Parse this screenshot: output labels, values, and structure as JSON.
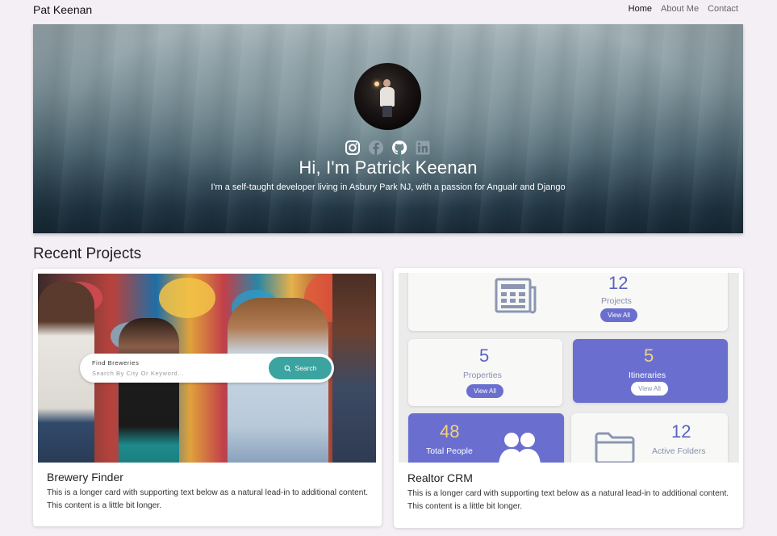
{
  "nav": {
    "brand": "Pat Keenan",
    "links": [
      "Home",
      "About Me",
      "Contact"
    ]
  },
  "hero": {
    "title": "Hi, I'm Patrick Keenan",
    "subtitle": "I'm a self-taught developer living in Asbury Park NJ, with a passion for Angualr and Django",
    "socials": [
      "instagram-icon",
      "facebook-icon",
      "github-icon",
      "linkedin-icon"
    ]
  },
  "projects": {
    "section_title": "Recent Projects",
    "cards": [
      {
        "title": "Brewery Finder",
        "text": "This is a longer card with supporting text below as a natural lead-in to additional content. This content is a little bit longer.",
        "image": {
          "search_label": "Find Breweries",
          "search_placeholder": "Search By City Or Keyword...",
          "search_button": "Search"
        }
      },
      {
        "title": "Realtor CRM",
        "text": "This is a longer card with supporting text below as a natural lead-in to additional content. This content is a little bit longer.",
        "image": {
          "projects": {
            "value": "12",
            "label": "Projects",
            "button": "View All"
          },
          "properties": {
            "value": "5",
            "label": "Properties",
            "button": "View All"
          },
          "itineraries": {
            "value": "5",
            "label": "Itineraries",
            "button": "View All"
          },
          "people": {
            "value": "48",
            "label": "Total People"
          },
          "folders": {
            "value": "12",
            "label": "Active Folders"
          }
        }
      }
    ]
  },
  "colors": {
    "accent_teal": "#3ba3a0",
    "accent_purple": "#6a6fcf",
    "page_bg": "#f3eff5"
  }
}
